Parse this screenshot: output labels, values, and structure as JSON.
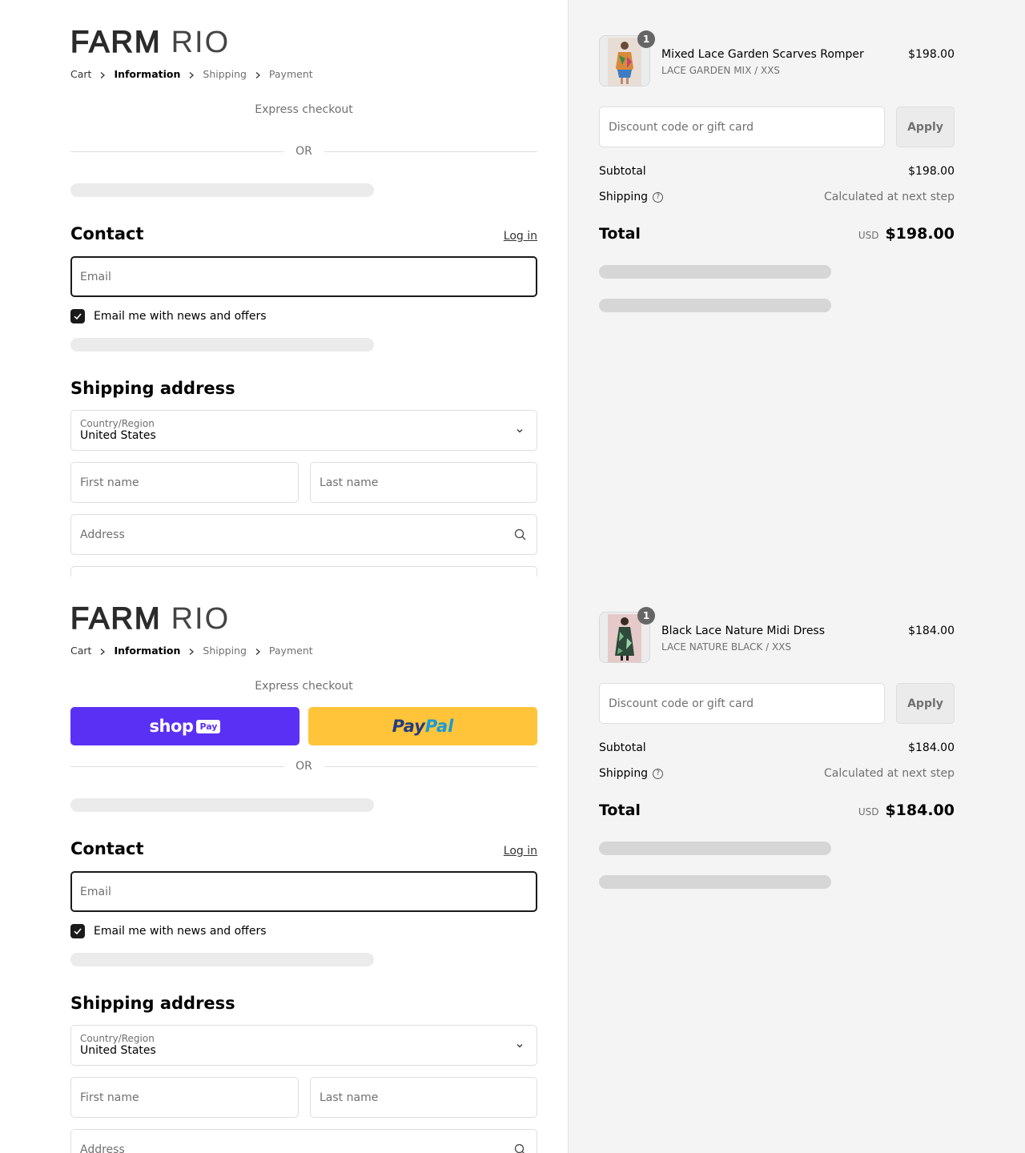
{
  "brand": {
    "logo_bold": "FARM",
    "logo_light": "RIO"
  },
  "breadcrumb": [
    "Cart",
    "Information",
    "Shipping",
    "Payment"
  ],
  "express_checkout": "Express checkout",
  "payment_buttons": {
    "shop_word": "shop",
    "shop_pill": "Pay",
    "paypal_part1": "Pay",
    "paypal_part2": "Pal"
  },
  "divider": "OR",
  "contact": {
    "heading": "Contact",
    "login": "Log in",
    "email_placeholder": "Email",
    "newsletter_label": "Email me with news and offers",
    "newsletter_checked": true
  },
  "shipping": {
    "heading": "Shipping address",
    "country_label": "Country/Region",
    "country_value": "United States",
    "first_name_placeholder": "First name",
    "last_name_placeholder": "Last name",
    "address_placeholder": "Address"
  },
  "summary_labels": {
    "discount_placeholder": "Discount code or gift card",
    "apply": "Apply",
    "subtotal": "Subtotal",
    "shipping": "Shipping",
    "shipping_value": "Calculated at next step",
    "total": "Total",
    "currency": "USD"
  },
  "frames": [
    {
      "item": {
        "quantity": "1",
        "name": "Mixed Lace Garden Scarves Romper",
        "variant": "LACE GARDEN MIX / XXS",
        "price": "$198.00"
      },
      "subtotal": "$198.00",
      "total": "$198.00",
      "show_payment_buttons": false
    },
    {
      "item": {
        "quantity": "1",
        "name": "Black Lace Nature Midi Dress",
        "variant": "LACE NATURE BLACK / XXS",
        "price": "$184.00"
      },
      "subtotal": "$184.00",
      "total": "$184.00",
      "show_payment_buttons": true
    }
  ],
  "colors": {
    "shop_pay": "#5a31f4",
    "paypal": "#ffc439",
    "summary_bg": "#f4f4f4"
  },
  "icons": [
    "chevron-right-icon",
    "chevron-down-icon",
    "search-icon",
    "checkmark-icon",
    "question-icon"
  ]
}
